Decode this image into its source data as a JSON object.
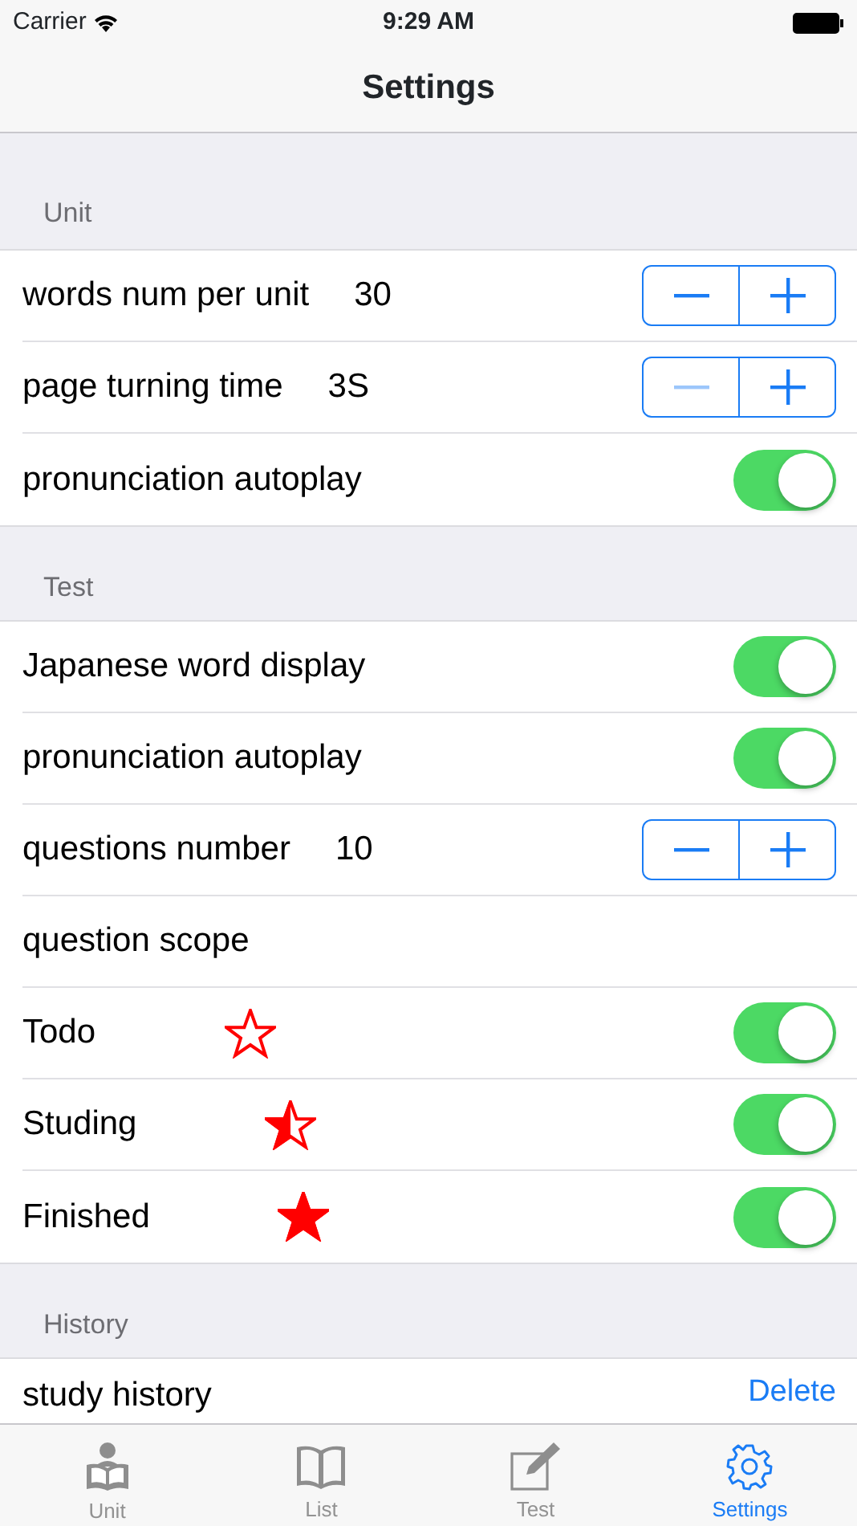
{
  "status_bar": {
    "carrier": "Carrier",
    "time": "9:29 AM"
  },
  "nav_bar": {
    "title": "Settings"
  },
  "sections": [
    {
      "header": "Unit",
      "rows": [
        {
          "kind": "stepper",
          "label": "words num per unit",
          "value": "30",
          "minus_disabled": false
        },
        {
          "kind": "stepper",
          "label": "page turning time",
          "value": "3S",
          "minus_disabled": true
        },
        {
          "kind": "switch",
          "label": "pronunciation autoplay",
          "on": true
        }
      ]
    },
    {
      "header": "Test",
      "rows": [
        {
          "kind": "switch",
          "label": "Japanese word display",
          "on": true
        },
        {
          "kind": "switch",
          "label": "pronunciation autoplay",
          "on": true
        },
        {
          "kind": "stepper",
          "label": "questions number",
          "value": "10",
          "minus_disabled": false
        },
        {
          "kind": "plain",
          "label": "question scope"
        },
        {
          "kind": "empty-star",
          "label": "Todo",
          "on": true
        },
        {
          "kind": "half-star",
          "label": "Studing",
          "on": true
        },
        {
          "kind": "full-star",
          "label": "Finished",
          "on": true
        }
      ]
    },
    {
      "header": "History",
      "rows": [
        {
          "kind": "action",
          "label": "study history",
          "action": "Delete"
        }
      ]
    }
  ],
  "tab_bar": [
    {
      "label": "Unit",
      "selected": false
    },
    {
      "label": "List",
      "selected": false
    },
    {
      "label": "Test",
      "selected": false
    },
    {
      "label": "Settings",
      "selected": true
    }
  ]
}
